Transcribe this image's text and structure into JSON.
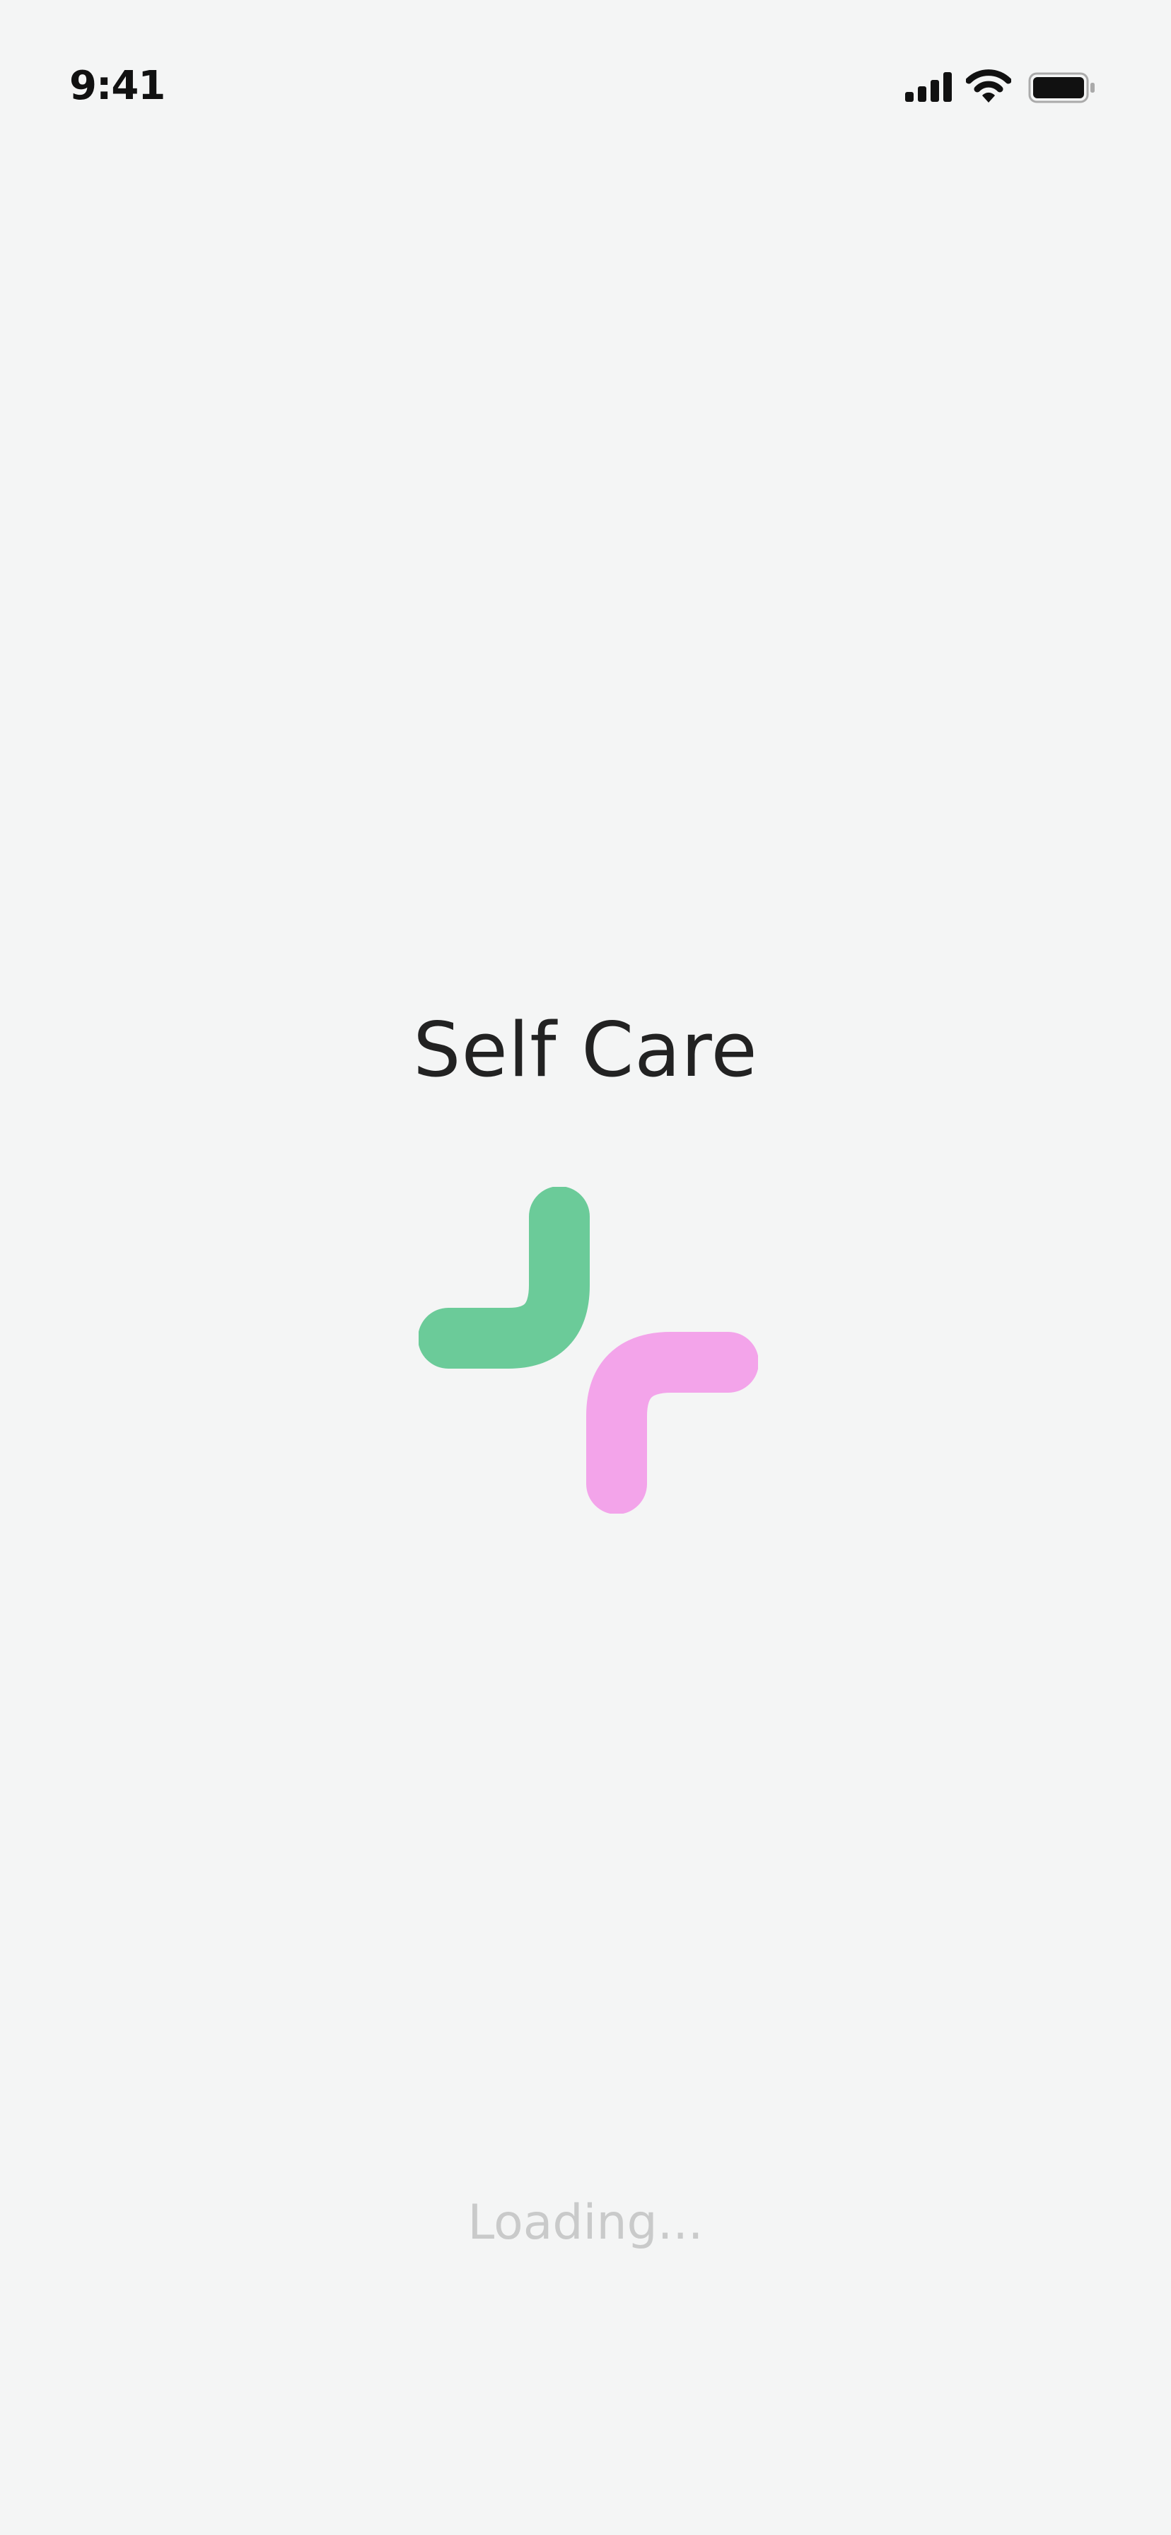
{
  "status_bar": {
    "time": "9:41",
    "icons": [
      "signal-icon",
      "wifi-icon",
      "battery-icon"
    ]
  },
  "app": {
    "title": "Self Care",
    "logo": {
      "icon": "self-care-cross-logo",
      "colors": {
        "green": "#6BCB99",
        "pink": "#F3A4EA"
      }
    }
  },
  "loading": {
    "text": "Loading..."
  },
  "colors": {
    "background": "#F4F5F5",
    "text": "#222222",
    "muted": "#C9CACA"
  }
}
